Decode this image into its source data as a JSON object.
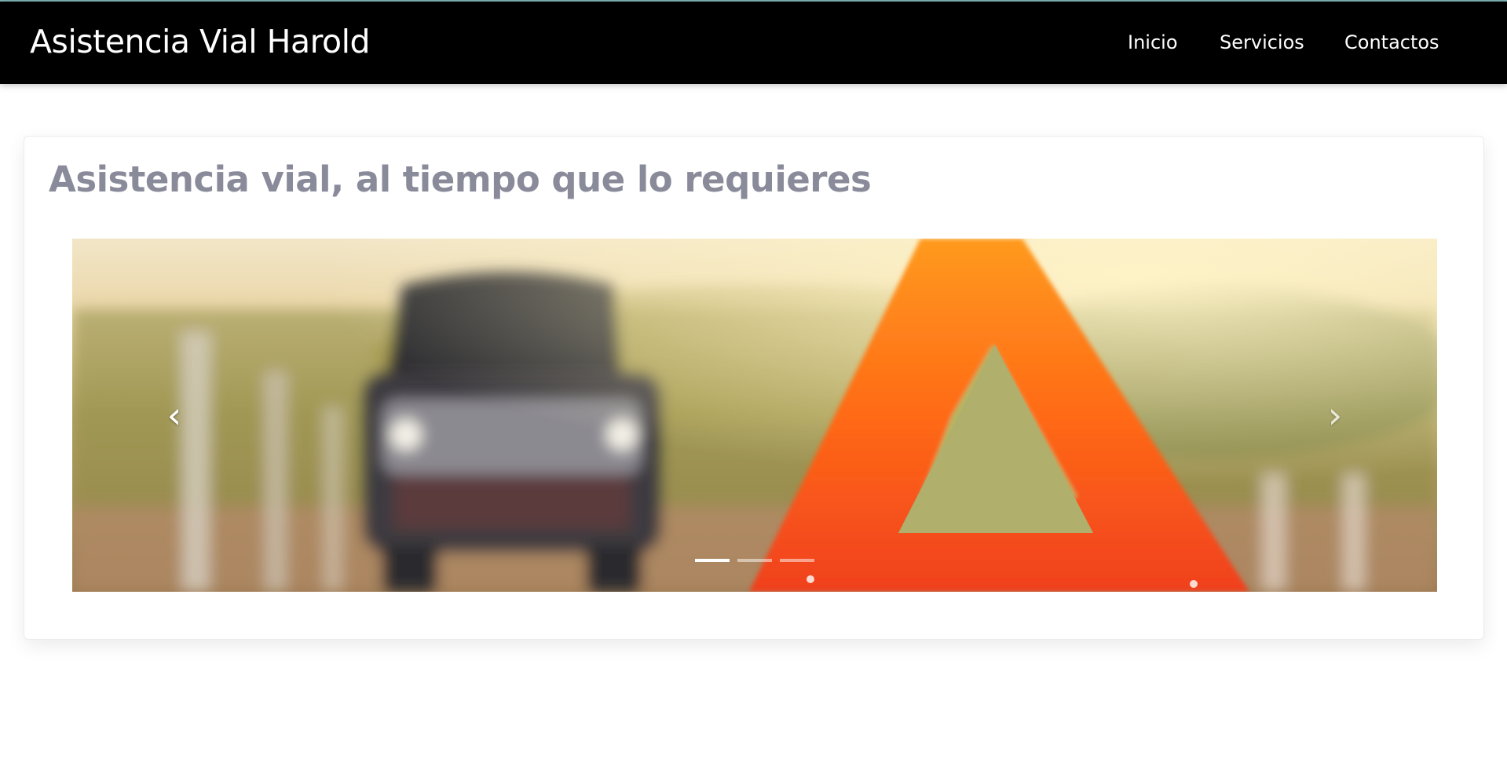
{
  "navbar": {
    "brand": "Asistencia Vial Harold",
    "links": [
      "Inicio",
      "Servicios",
      "Contactos"
    ]
  },
  "hero": {
    "title": "Asistencia vial, al tiempo que lo requieres"
  },
  "carousel": {
    "prev_icon": "‹",
    "next_icon": "›",
    "slide_count": 3,
    "active_index": 0
  },
  "colors": {
    "navbar_bg": "#000000",
    "title_color": "#8a8b9a",
    "triangle_red": "#f0461e"
  }
}
